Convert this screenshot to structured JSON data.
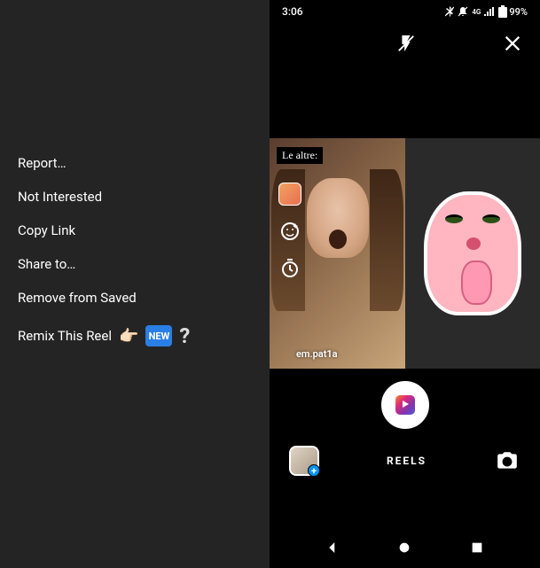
{
  "status_bar": {
    "time": "3:06",
    "battery": "99%"
  },
  "menu": {
    "items": [
      {
        "label": "Report…"
      },
      {
        "label": "Not Interested"
      },
      {
        "label": "Copy Link"
      },
      {
        "label": "Share to…"
      },
      {
        "label": "Remove from Saved"
      },
      {
        "label": "Remix This Reel",
        "badge": "NEW"
      }
    ]
  },
  "preview": {
    "overlay_text": "Le altre:",
    "username": "em.pat1a"
  },
  "bottom": {
    "mode_label": "REELS"
  }
}
